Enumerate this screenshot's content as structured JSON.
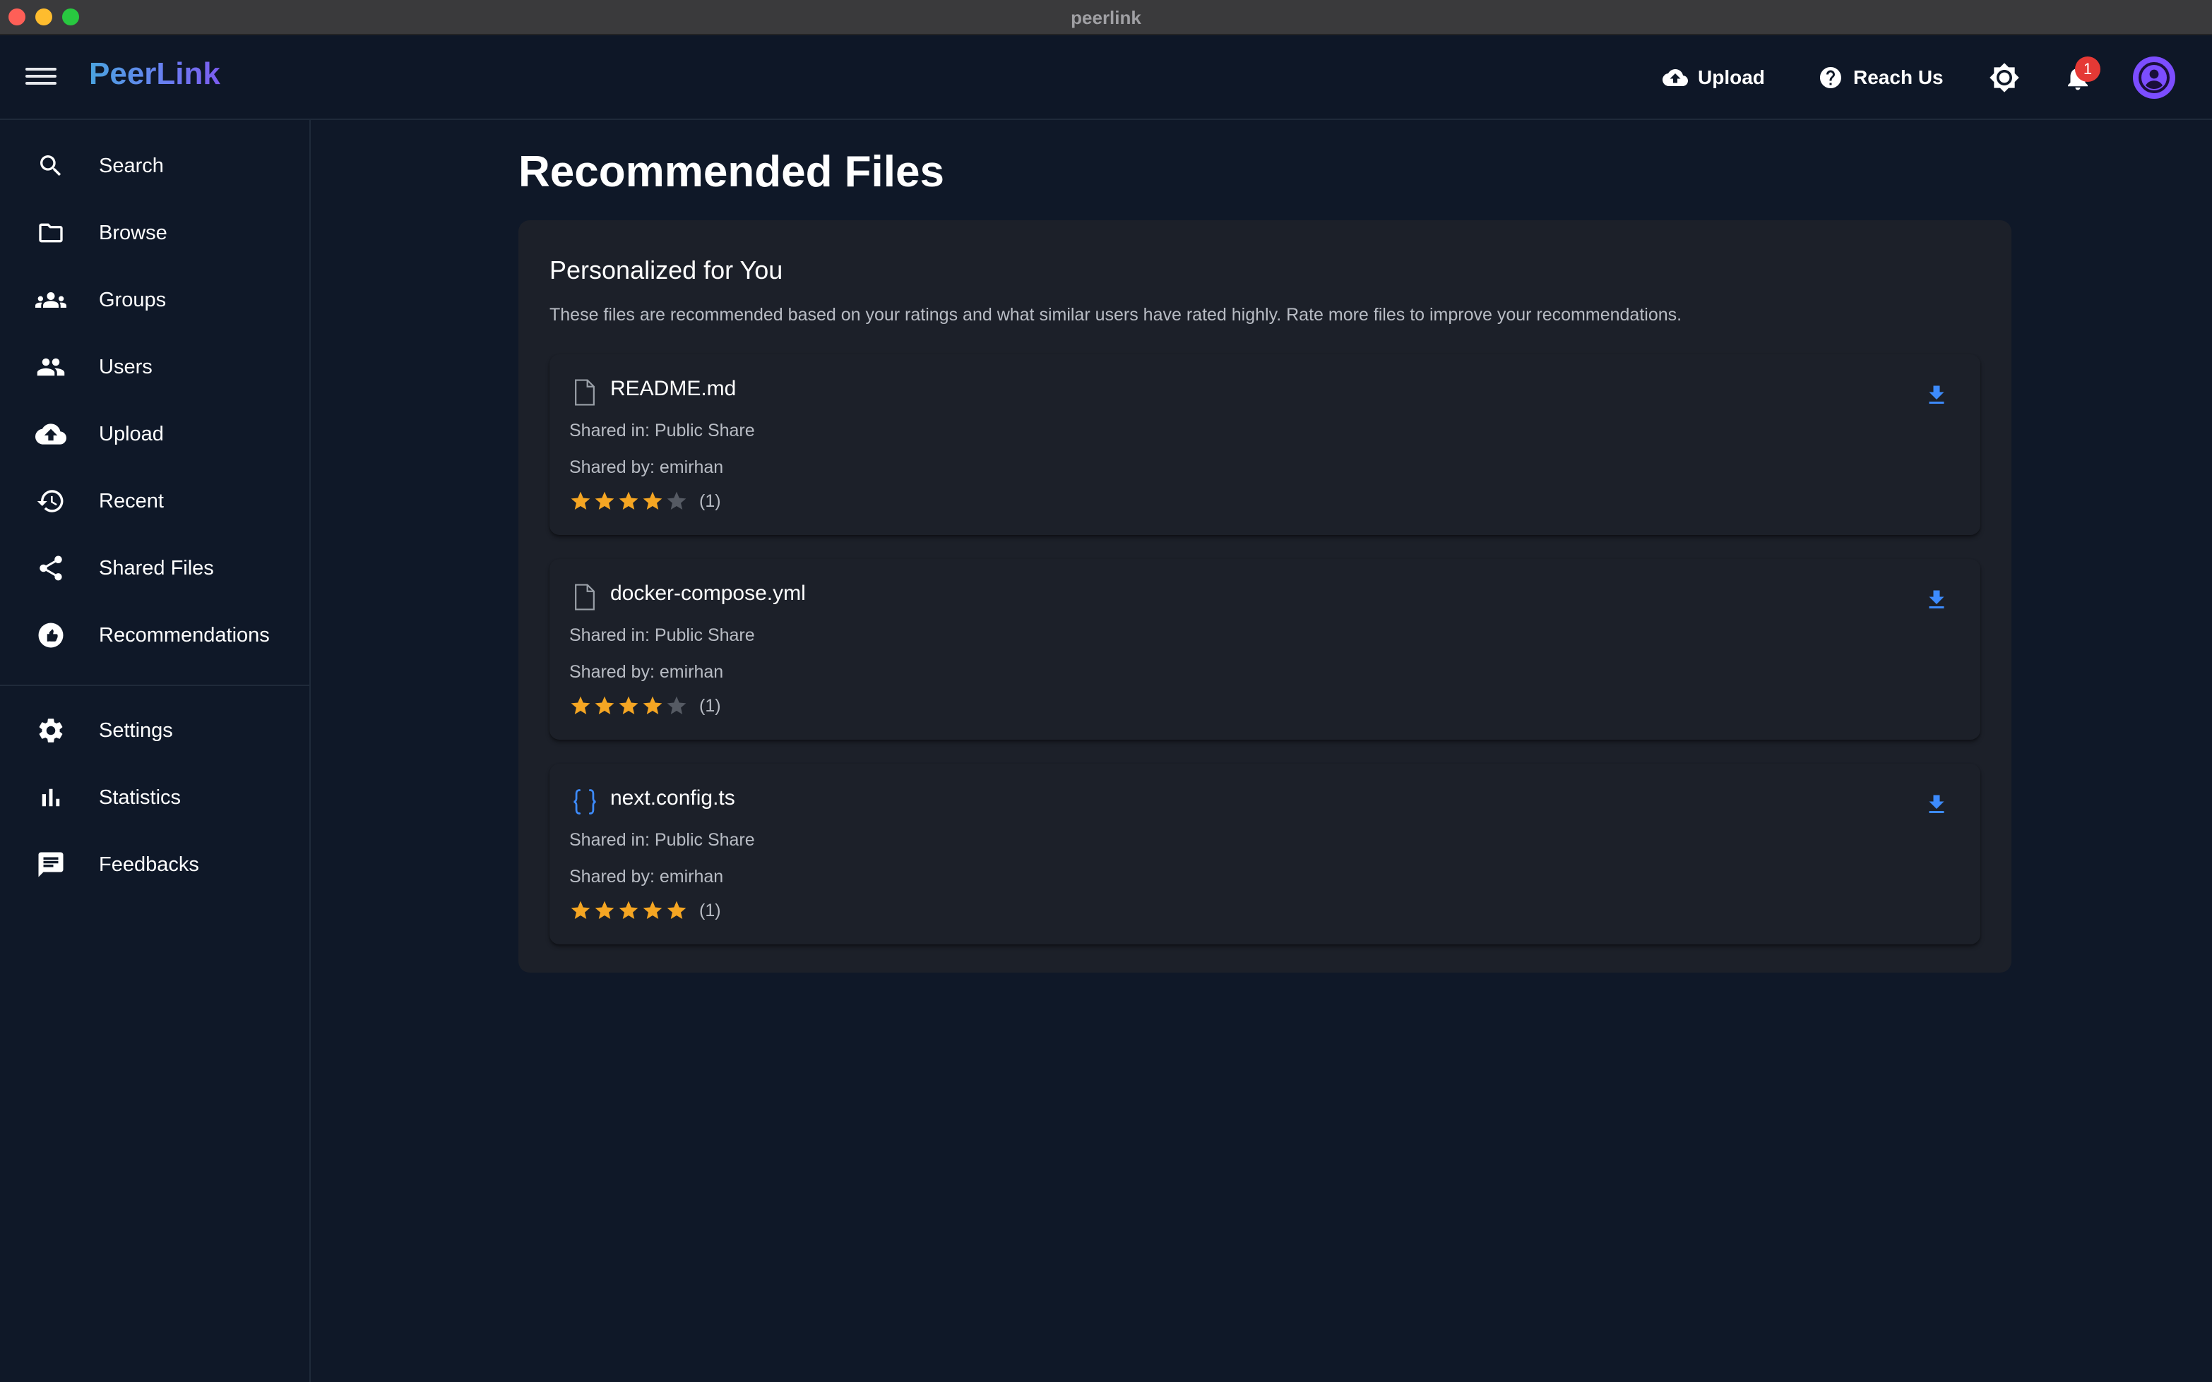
{
  "window": {
    "title": "peerlink"
  },
  "header": {
    "brand": "PeerLink",
    "upload_label": "Upload",
    "reach_label": "Reach Us",
    "notification_count": "1"
  },
  "sidebar": {
    "items": [
      {
        "label": "Search",
        "icon": "search-icon"
      },
      {
        "label": "Browse",
        "icon": "folder-icon"
      },
      {
        "label": "Groups",
        "icon": "groups-icon"
      },
      {
        "label": "Users",
        "icon": "users-icon"
      },
      {
        "label": "Upload",
        "icon": "cloud-upload-icon"
      },
      {
        "label": "Recent",
        "icon": "history-icon"
      },
      {
        "label": "Shared Files",
        "icon": "share-icon"
      },
      {
        "label": "Recommendations",
        "icon": "recommendation-icon"
      }
    ],
    "secondary_items": [
      {
        "label": "Settings",
        "icon": "gear-icon"
      },
      {
        "label": "Statistics",
        "icon": "bar-chart-icon"
      },
      {
        "label": "Feedbacks",
        "icon": "feedback-icon"
      }
    ]
  },
  "main": {
    "title": "Recommended Files",
    "panel": {
      "title": "Personalized for You",
      "description": "These files are recommended based on your ratings and what similar users have rated highly. Rate more files to improve your recommendations."
    },
    "files": [
      {
        "name": "README.md",
        "icon": "file-icon",
        "shared_in": "Shared in: Public Share",
        "shared_by": "Shared by: emirhan",
        "rating": 4,
        "rating_count": "(1)"
      },
      {
        "name": "docker-compose.yml",
        "icon": "file-icon",
        "shared_in": "Shared in: Public Share",
        "shared_by": "Shared by: emirhan",
        "rating": 4,
        "rating_count": "(1)"
      },
      {
        "name": "next.config.ts",
        "icon": "code-braces-icon",
        "shared_in": "Shared in: Public Share",
        "shared_by": "Shared by: emirhan",
        "rating": 5,
        "rating_count": "(1)"
      }
    ]
  },
  "colors": {
    "background": "#0f1828",
    "panel": "#1c2029",
    "star_filled": "#f5a623",
    "star_empty": "#555a63",
    "accent_blue": "#3d8bfd",
    "avatar": "#7c4dff",
    "badge": "#e53935"
  }
}
